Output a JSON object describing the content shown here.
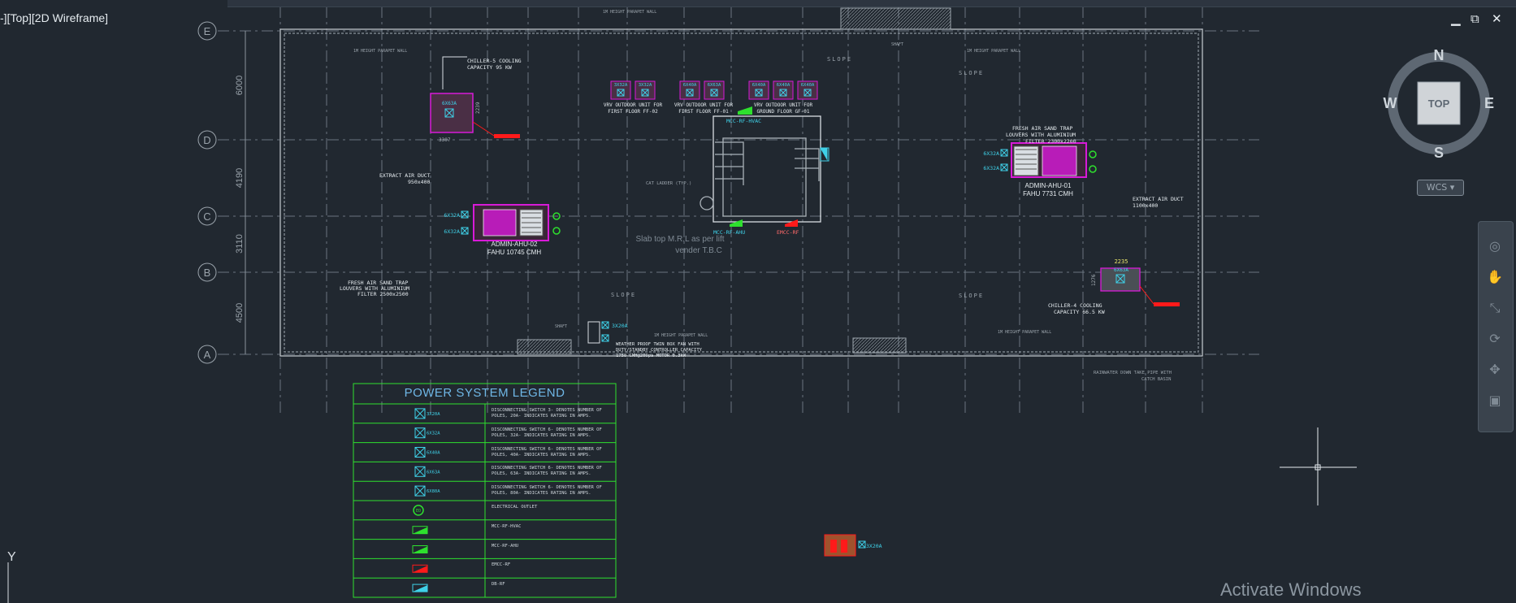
{
  "viewport": {
    "label": "-][Top][2D Wireframe]"
  },
  "window_controls": {
    "minimize": "▁",
    "restore": "⧉",
    "close": "✕"
  },
  "viewcube": {
    "north": "N",
    "south": "S",
    "east": "E",
    "west": "W",
    "top_face": "TOP"
  },
  "wcs_button": "WCS ▾",
  "ucs": {
    "y_label": "Y"
  },
  "grid": {
    "row_labels": [
      "E",
      "D",
      "C",
      "B",
      "A"
    ],
    "dimensions": [
      "6000",
      "4190",
      "3110",
      "4500"
    ]
  },
  "equipment": {
    "chiller5": {
      "label": "CHILLER-5 COOLING",
      "capacity": "CAPACITY 95 KW",
      "switch": "6X63A",
      "dim_w": "3307",
      "dim_h": "2239"
    },
    "chiller4": {
      "label": "CHILLER-4 COOLING",
      "capacity": "CAPACITY 66.5 KW",
      "switch": "6X63A",
      "dim_w": "2235",
      "dim_h": "1276"
    },
    "ahu01": {
      "name": "ADMIN-AHU-01",
      "flow": "FAHU 7731 CMH",
      "switches": [
        "6X32A",
        "6X32A"
      ]
    },
    "ahu02": {
      "name": "ADMIN-AHU-02",
      "flow": "FAHU 10745 CMH",
      "switches": [
        "6X32A",
        "6X32A"
      ]
    }
  },
  "vrv_units": {
    "ff02": {
      "caption": "VRV OUTDOOR UNIT FOR",
      "floor": "FIRST FLOOR FF-02",
      "switches": [
        "3X32A",
        "3X32A"
      ]
    },
    "ff01": {
      "caption": "VRV OUTDOOR UNIT FOR",
      "floor": "FIRST FLOOR FF-01",
      "switches": [
        "6X40A",
        "6X63A"
      ]
    },
    "gf01": {
      "caption": "VRV OUTDOOR UNIT FOR",
      "floor": "GROUND FLOOR GF-01",
      "switches": [
        "6X40A",
        "6X40A",
        "6X40A"
      ]
    }
  },
  "notes": {
    "parapet": "1M HEIGHT PARAPET WALL",
    "slope": "SLOPE",
    "shaft": "SHAFT",
    "extract_left": "EXTRACT AIR DUCT",
    "extract_left_size": "950x400",
    "extract_right": "EXTRACT AIR DUCT",
    "extract_right_size": "1100x400",
    "fresh_left_1": "FRESH AIR SAND TRAP",
    "fresh_left_2": "LOUVERS WITH ALUMINIUM",
    "fresh_left_3": "FILTER 2500x2500",
    "fresh_right_1": "FRESH AIR SAND TRAP",
    "fresh_right_2": "LOUVERS WITH ALUMINIUM",
    "fresh_right_3": "FILTER 2300x2200",
    "slab_1": "Slab top M.R.L as per lift",
    "slab_2": "vender T.B.C",
    "cat_ladder": "CAT LADDER (TYP.)",
    "mcc_rf_hvac": "MCC-RF-HVAC",
    "mcc_rf_ahu": "MCC-RF-AHU",
    "emcc_rf": "EMCC-RF",
    "fan_1": "WEATHER PROOF TWIN BOX FAN WITH",
    "fan_2": "DUTY/STANDBY CONTROLLER CAPACITY",
    "fan_3": "1750 CMH@200pa  MOTOR 0.3kW",
    "rainwater_1": "RAINWATER DOWN TAKE PIPE WITH",
    "rainwater_2": "CATCH BASIN",
    "switch_3x20a": "3X20A",
    "switch_3x20a_b": "3X20A"
  },
  "legend": {
    "title": "POWER SYSTEM LEGEND",
    "rows": [
      {
        "symbol": "3X20A",
        "desc": "DISCONNECTING SWITCH 3- DENOTES NUMBER OF POLES, 20A- INDICATES RATING IN AMPS."
      },
      {
        "symbol": "6X32A",
        "desc": "DISCONNECTING SWITCH 6- DENOTES NUMBER OF POLES, 32A- INDICATES RATING IN AMPS."
      },
      {
        "symbol": "6X40A",
        "desc": "DISCONNECTING SWITCH 6- DENOTES NUMBER OF POLES, 40A- INDICATES RATING IN AMPS."
      },
      {
        "symbol": "6X63A",
        "desc": "DISCONNECTING SWITCH 6- DENOTES NUMBER OF POLES, 63A- INDICATES RATING IN AMPS."
      },
      {
        "symbol": "6X80A",
        "desc": "DISCONNECTING SWITCH 6- DENOTES NUMBER OF POLES, 80A- INDICATES RATING IN AMPS."
      },
      {
        "symbol": "EO",
        "desc": "ELECTRICAL OUTLET"
      },
      {
        "symbol": "",
        "desc": "MCC-RF-HVAC"
      },
      {
        "symbol": "",
        "desc": "MCC-RF-AHU"
      },
      {
        "symbol": "",
        "desc": "EMCC-RF"
      },
      {
        "symbol": "",
        "desc": "DB-RF"
      }
    ]
  },
  "activation_watermark": "Activate Windows",
  "colors": {
    "background": "#212830",
    "cad_white": "#d9dee3",
    "grid_gray": "#5f6b76",
    "magenta": "#d81ad8",
    "cyan": "#3fd1e8",
    "green": "#2ee02e",
    "red": "#ff1a1a"
  }
}
